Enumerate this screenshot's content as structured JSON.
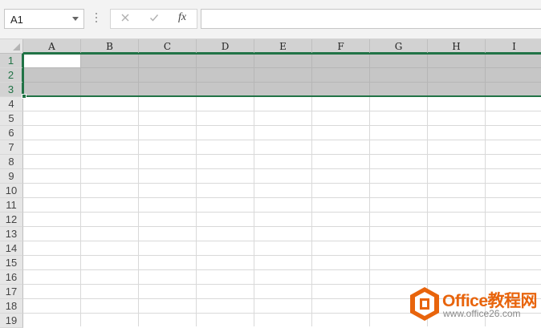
{
  "formula_bar": {
    "name_box_value": "A1",
    "cancel_icon": "x-icon",
    "enter_icon": "check-icon",
    "function_label": "fx",
    "formula_value": ""
  },
  "sheet": {
    "columns": [
      "A",
      "B",
      "C",
      "D",
      "E",
      "F",
      "G",
      "H",
      "I"
    ],
    "rows": [
      "1",
      "2",
      "3",
      "4",
      "5",
      "6",
      "7",
      "8",
      "9",
      "10",
      "11",
      "12",
      "13",
      "14",
      "15",
      "16",
      "17",
      "18",
      "19"
    ],
    "selection": "A1:I3",
    "active_cell": "A1",
    "accent_color": "#217346",
    "selection_fill_color": "#c6c6c6"
  },
  "watermark": {
    "brand": "Office教程网",
    "url": "www.office26.com",
    "brand_color": "#e8640c"
  }
}
